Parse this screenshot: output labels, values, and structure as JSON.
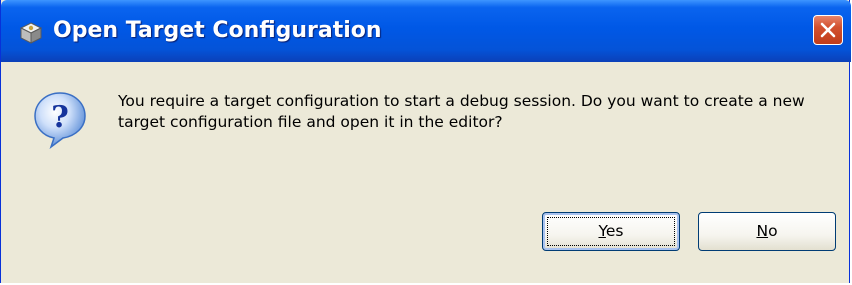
{
  "window": {
    "title_part1": "Open Target Configuration",
    "close_symbol": "×"
  },
  "dialog": {
    "icon": "question-icon",
    "message": "You require a target configuration to start a debug session. Do you want to create a new target configuration file and open it in the editor?"
  },
  "buttons": {
    "yes_accel": "Y",
    "yes_rest": "es",
    "no_accel": "N",
    "no_rest": "o"
  },
  "colors": {
    "titlebar": "#0058e6",
    "close": "#d2512f",
    "dialog_bg": "#ece9d8",
    "icon_blue": "#2a6fd6"
  }
}
